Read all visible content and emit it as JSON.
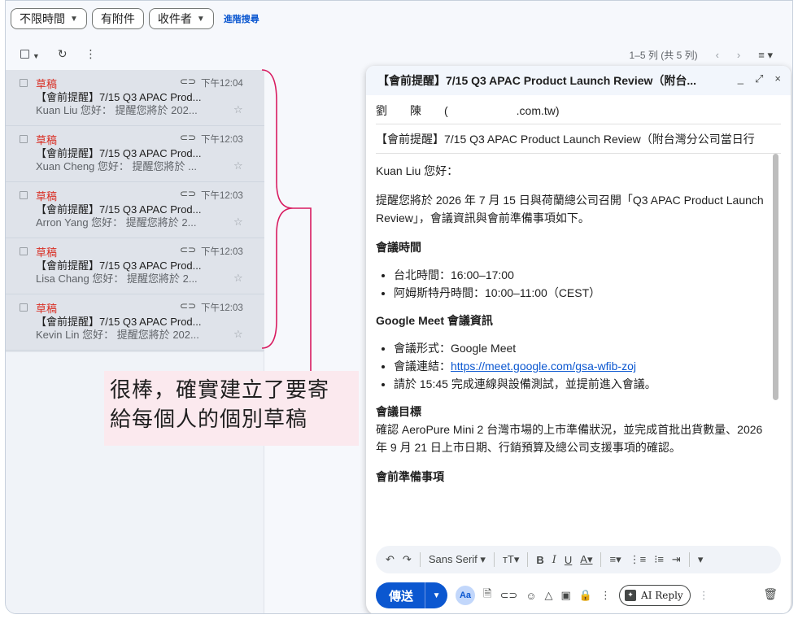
{
  "filters": {
    "time": "不限時間",
    "attachment": "有附件",
    "recipient": "收件者",
    "advanced": "進階搜尋"
  },
  "pager": {
    "range": "1–5 列 (共 5 列)"
  },
  "messages": [
    {
      "label": "草稿",
      "time": "下午12:04",
      "subject": "【會前提醒】7/15 Q3 APAC Prod...",
      "snippet": "Kuan Liu 您好： 提醒您將於 202..."
    },
    {
      "label": "草稿",
      "time": "下午12:03",
      "subject": "【會前提醒】7/15 Q3 APAC Prod...",
      "snippet": "Xuan Cheng 您好： 提醒您將於 ..."
    },
    {
      "label": "草稿",
      "time": "下午12:03",
      "subject": "【會前提醒】7/15 Q3 APAC Prod...",
      "snippet": "Arron Yang 您好： 提醒您將於 2..."
    },
    {
      "label": "草稿",
      "time": "下午12:03",
      "subject": "【會前提醒】7/15 Q3 APAC Prod...",
      "snippet": "Lisa Chang 您好： 提醒您將於 2..."
    },
    {
      "label": "草稿",
      "time": "下午12:03",
      "subject": "【會前提醒】7/15 Q3 APAC Prod...",
      "snippet": "Kevin Lin 您好： 提醒您將於 202..."
    }
  ],
  "annotation": {
    "line1": "很棒，確實建立了要寄",
    "line2": "給每個人的個別草稿"
  },
  "compose": {
    "title": "【會前提醒】7/15 Q3 APAC Product Launch Review（附台...",
    "to": "劉　　陳　　(　　　　　　.com.tw)",
    "subject": "【會前提醒】7/15 Q3 APAC Product Launch Review（附台灣分公司當日行",
    "greeting": "Kuan Liu 您好：",
    "intro": "提醒您將於 2026 年 7 月 15 日與荷蘭總公司召開「Q3 APAC Product Launch Review」，會議資訊與會前準備事項如下。",
    "h_time": "會議時間",
    "time_items": [
      "台北時間：16:00–17:00",
      "阿姆斯特丹時間：10:00–11:00（CEST）"
    ],
    "h_meet": "Google Meet 會議資訊",
    "meet_format": "會議形式：Google Meet",
    "meet_link_label": "會議連結：",
    "meet_link": "https://meet.google.com/gsa-wfib-zoj",
    "meet_prep": "請於 15:45 完成連線與設備測試，並提前進入會議。",
    "h_goal": "會議目標",
    "goal": "確認 AeroPure Mini 2 台灣市場的上市準備狀況，並完成首批出貨數量、2026 年 9 月 21 日上市日期、行銷預算及總公司支援事項的確認。",
    "h_prep": "會前準備事項",
    "font": "Sans Serif",
    "send": "傳送",
    "ai_reply": "AI Reply"
  }
}
